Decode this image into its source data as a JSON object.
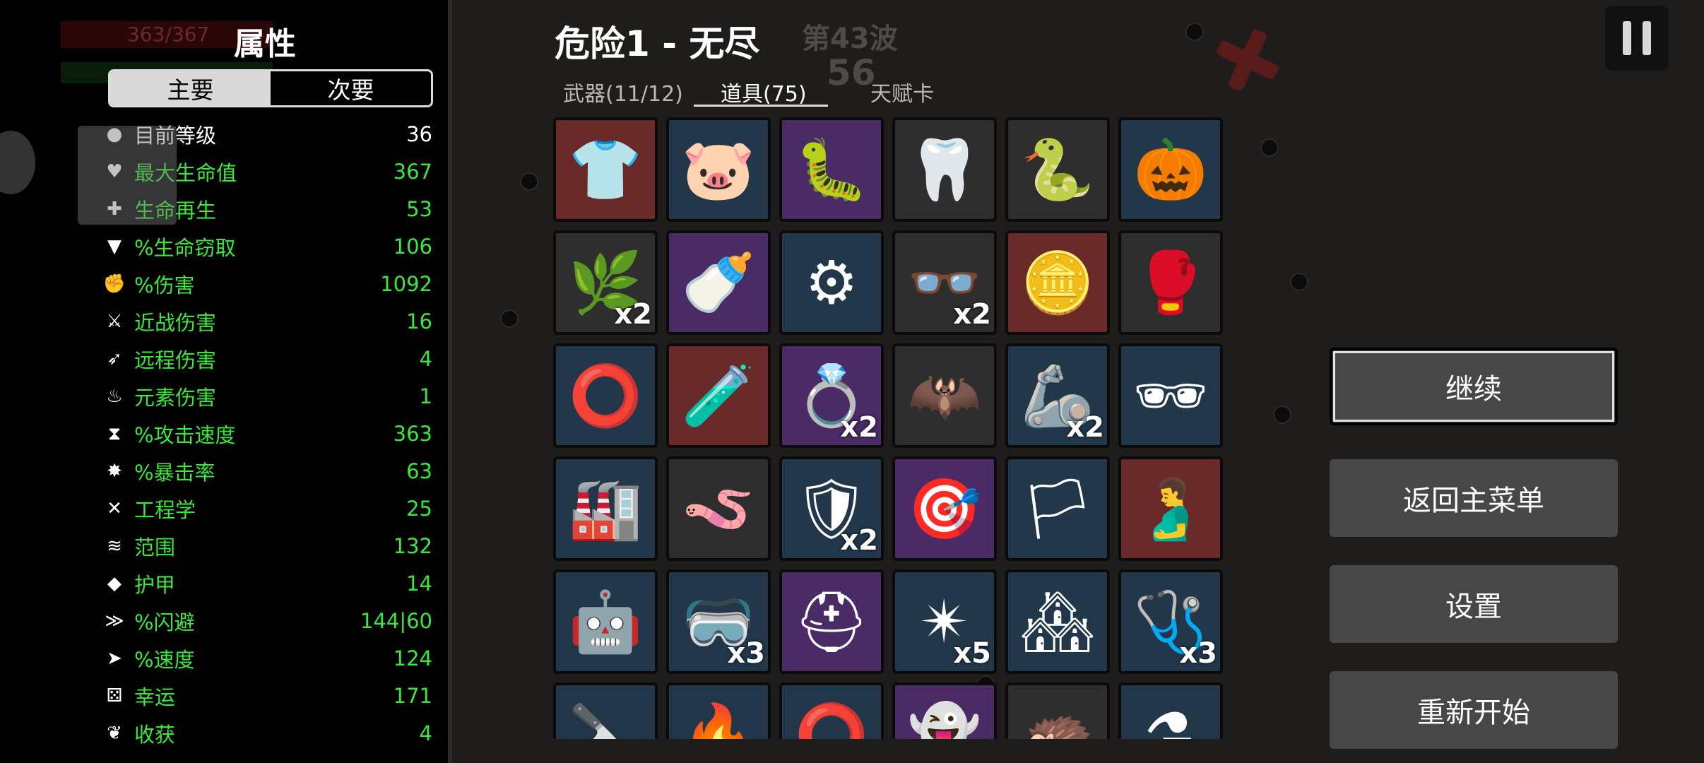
{
  "stats_panel": {
    "title": "属性",
    "hp_text": "363/367",
    "segments": {
      "primary": "主要",
      "secondary": "次要"
    },
    "stats": [
      {
        "icon": "level-icon",
        "glyph": "●",
        "label": "目前等级",
        "value": "36",
        "style": "white"
      },
      {
        "icon": "heart-icon",
        "glyph": "♥",
        "label": "最大生命值",
        "value": "367",
        "style": "green"
      },
      {
        "icon": "heart-plus-icon",
        "glyph": "✚",
        "label": "生命再生",
        "value": "53",
        "style": "green"
      },
      {
        "icon": "fangs-icon",
        "glyph": "▼",
        "label": "%生命窃取",
        "value": "106",
        "style": "green"
      },
      {
        "icon": "fist-icon",
        "glyph": "✊",
        "label": "%伤害",
        "value": "1092",
        "style": "green"
      },
      {
        "icon": "sword-icon",
        "glyph": "⚔",
        "label": "近战伤害",
        "value": "16",
        "style": "green"
      },
      {
        "icon": "bow-icon",
        "glyph": "➶",
        "label": "远程伤害",
        "value": "4",
        "style": "green"
      },
      {
        "icon": "flame-icon",
        "glyph": "♨",
        "label": "元素伤害",
        "value": "1",
        "style": "green"
      },
      {
        "icon": "hourglass-icon",
        "glyph": "⧗",
        "label": "%攻击速度",
        "value": "363",
        "style": "green"
      },
      {
        "icon": "crit-icon",
        "glyph": "✸",
        "label": "%暴击率",
        "value": "63",
        "style": "green"
      },
      {
        "icon": "wrench-icon",
        "glyph": "✕",
        "label": "工程学",
        "value": "25",
        "style": "green"
      },
      {
        "icon": "range-icon",
        "glyph": "≋",
        "label": "范围",
        "value": "132",
        "style": "green"
      },
      {
        "icon": "shield-icon",
        "glyph": "◆",
        "label": "护甲",
        "value": "14",
        "style": "green"
      },
      {
        "icon": "dodge-icon",
        "glyph": "≫",
        "label": "%闪避",
        "value": "144|60",
        "style": "green"
      },
      {
        "icon": "boot-icon",
        "glyph": "➤",
        "label": "%速度",
        "value": "124",
        "style": "green"
      },
      {
        "icon": "dice-icon",
        "glyph": "⚄",
        "label": "幸运",
        "value": "171",
        "style": "green"
      },
      {
        "icon": "harvest-icon",
        "glyph": "❦",
        "label": "收获",
        "value": "4",
        "style": "green"
      }
    ]
  },
  "header": {
    "title": "危险1 - 无尽",
    "wave": "第43波",
    "timer": "56",
    "tabs": {
      "weapons": "武器(11/12)",
      "items": "道具(75)",
      "talents": "天赋卡"
    }
  },
  "items": [
    {
      "name": "hoodie-icon",
      "glyph": "👕",
      "tier": "t4",
      "count": ""
    },
    {
      "name": "piggy-bank-icon",
      "glyph": "🐷",
      "tier": "t2",
      "count": ""
    },
    {
      "name": "tardigrade-icon",
      "glyph": "🐛",
      "tier": "t3",
      "count": ""
    },
    {
      "name": "tooth-icon",
      "glyph": "🦷",
      "tier": "t1",
      "count": ""
    },
    {
      "name": "snake-icon",
      "glyph": "🐍",
      "tier": "t1",
      "count": ""
    },
    {
      "name": "pumpkin-icon",
      "glyph": "🎃",
      "tier": "t2",
      "count": ""
    },
    {
      "name": "fertilizer-bag-icon",
      "glyph": "🌿",
      "tier": "t1",
      "count": "x2"
    },
    {
      "name": "bottle-icon",
      "glyph": "🍼",
      "tier": "t3",
      "count": ""
    },
    {
      "name": "gear-icon",
      "glyph": "⚙",
      "tier": "t2",
      "count": ""
    },
    {
      "name": "glasses-icon",
      "glyph": "👓",
      "tier": "t1",
      "count": "x2"
    },
    {
      "name": "coin-icon",
      "glyph": "🪙",
      "tier": "t4",
      "count": ""
    },
    {
      "name": "boxing-glove-icon",
      "glyph": "🥊",
      "tier": "t1",
      "count": ""
    },
    {
      "name": "bracelet-icon",
      "glyph": "⭕",
      "tier": "t2",
      "count": ""
    },
    {
      "name": "test-tube-icon",
      "glyph": "🧪",
      "tier": "t4",
      "count": ""
    },
    {
      "name": "ring-icon",
      "glyph": "💍",
      "tier": "t3",
      "count": "x2"
    },
    {
      "name": "bat-icon",
      "glyph": "🦇",
      "tier": "t1",
      "count": ""
    },
    {
      "name": "robot-arm-icon",
      "glyph": "🦾",
      "tier": "t2",
      "count": "x2"
    },
    {
      "name": "eye-mask-icon",
      "glyph": "🕶",
      "tier": "t2",
      "count": ""
    },
    {
      "name": "machine-icon",
      "glyph": "🏭",
      "tier": "t2",
      "count": ""
    },
    {
      "name": "worm-icon",
      "glyph": "🪱",
      "tier": "t1",
      "count": ""
    },
    {
      "name": "gauntlet-icon",
      "glyph": "🛡",
      "tier": "t2",
      "count": "x2"
    },
    {
      "name": "drone-icon",
      "glyph": "🎯",
      "tier": "t3",
      "count": ""
    },
    {
      "name": "white-flag-icon",
      "glyph": "🏳",
      "tier": "t2",
      "count": ""
    },
    {
      "name": "stomach-icon",
      "glyph": "🫃",
      "tier": "t4",
      "count": ""
    },
    {
      "name": "turret-icon",
      "glyph": "🤖",
      "tier": "t2",
      "count": ""
    },
    {
      "name": "helmet-icon",
      "glyph": "🥽",
      "tier": "t2",
      "count": "x3"
    },
    {
      "name": "knight-helmet-icon",
      "glyph": "⛑",
      "tier": "t3",
      "count": ""
    },
    {
      "name": "claw-icon",
      "glyph": "✴",
      "tier": "t2",
      "count": "x5"
    },
    {
      "name": "factory-icon",
      "glyph": "🏘",
      "tier": "t2",
      "count": ""
    },
    {
      "name": "medic-turret-icon",
      "glyph": "🩺",
      "tier": "t2",
      "count": "x3"
    },
    {
      "name": "scalpel-icon",
      "glyph": "🔪",
      "tier": "t2",
      "count": ""
    },
    {
      "name": "fire-icon",
      "glyph": "🔥",
      "tier": "t2",
      "count": ""
    },
    {
      "name": "red-ring-icon",
      "glyph": "⭕",
      "tier": "t2",
      "count": ""
    },
    {
      "name": "ghost-icon",
      "glyph": "👻",
      "tier": "t3",
      "count": ""
    },
    {
      "name": "hedgehog-icon",
      "glyph": "🦔",
      "tier": "t1",
      "count": ""
    },
    {
      "name": "potion-icon",
      "glyph": "⚗",
      "tier": "t2",
      "count": ""
    }
  ],
  "buttons": {
    "continue": "继续",
    "main_menu": "返回主菜单",
    "settings": "设置",
    "restart": "重新开始"
  }
}
